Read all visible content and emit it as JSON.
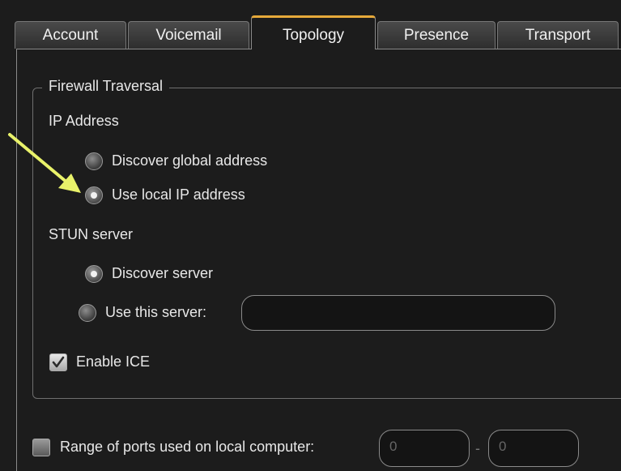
{
  "tabs": [
    "Account",
    "Voicemail",
    "Topology",
    "Presence",
    "Transport"
  ],
  "active_tab": "Topology",
  "group": {
    "title": "Firewall Traversal"
  },
  "ip_address": {
    "label": "IP Address",
    "options": [
      "Discover global address",
      "Use local IP address"
    ],
    "selected": "Use local IP address"
  },
  "stun": {
    "label": "STUN server",
    "options": [
      "Discover server",
      "Use this server:"
    ],
    "selected": "Discover server",
    "server_value": ""
  },
  "ice": {
    "label": "Enable ICE",
    "checked": true
  },
  "ports": {
    "label": "Range of ports used on local computer:",
    "checked": false,
    "from": "0",
    "separator": "-",
    "to": "0"
  },
  "colors": {
    "background": "#1c1c1c",
    "active_tab_accent": "#e6a93a",
    "arrow": "#e9f26a"
  }
}
